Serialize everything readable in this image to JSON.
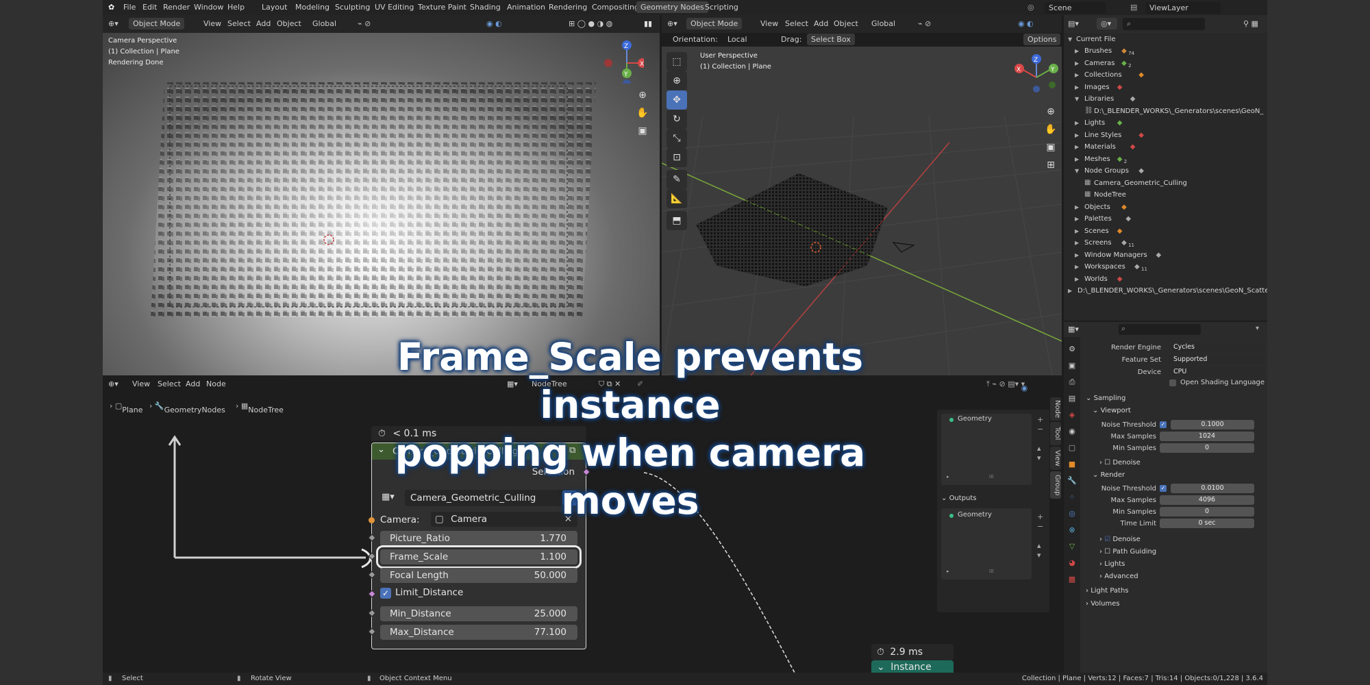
{
  "menu": {
    "file": "File",
    "edit": "Edit",
    "render": "Render",
    "window": "Window",
    "help": "Help"
  },
  "workspaces": [
    "Layout",
    "Modeling",
    "Sculpting",
    "UV Editing",
    "Texture Paint",
    "Shading",
    "Animation",
    "Rendering",
    "Compositing",
    "Geometry Nodes",
    "Scripting"
  ],
  "scene_name": "Scene",
  "view_layer": "ViewLayer",
  "viewport_left": {
    "mode": "Object Mode",
    "menus": [
      "View",
      "Select",
      "Add",
      "Object"
    ],
    "transform": "Global",
    "overlay_lines": [
      "Camera Perspective",
      "(1) Collection | Plane",
      "Rendering Done"
    ]
  },
  "viewport_right": {
    "mode": "Object Mode",
    "menus": [
      "View",
      "Select",
      "Add",
      "Object"
    ],
    "transform": "Global",
    "orientation_label": "Orientation:",
    "orientation_value": "Local",
    "drag_label": "Drag:",
    "drag_value": "Select Box",
    "options_label": "Options",
    "overlay_lines": [
      "User Perspective",
      "(1) Collection | Plane"
    ]
  },
  "gizmo": {
    "x": "X",
    "y": "Y",
    "z": "Z"
  },
  "outliner": {
    "root": "Current File",
    "items": [
      {
        "label": "Brushes",
        "badge": "74"
      },
      {
        "label": "Cameras",
        "badge": "2"
      },
      {
        "label": "Collections",
        "badge": ""
      },
      {
        "label": "Images",
        "badge": ""
      },
      {
        "label": "Libraries",
        "badge": ""
      },
      {
        "label": "D:\\_BLENDER_WORKS\\_Generators\\scenes\\GeoN_",
        "badge": ""
      },
      {
        "label": "Lights",
        "badge": ""
      },
      {
        "label": "Line Styles",
        "badge": ""
      },
      {
        "label": "Materials",
        "badge": ""
      },
      {
        "label": "Meshes",
        "badge": "2"
      },
      {
        "label": "Node Groups",
        "badge": ""
      },
      {
        "label": "Camera_Geometric_Culling",
        "badge": ""
      },
      {
        "label": "NodeTree",
        "badge": ""
      },
      {
        "label": "Objects",
        "badge": ""
      },
      {
        "label": "Palettes",
        "badge": ""
      },
      {
        "label": "Scenes",
        "badge": ""
      },
      {
        "label": "Screens",
        "badge": "11"
      },
      {
        "label": "Window Managers",
        "badge": ""
      },
      {
        "label": "Workspaces",
        "badge": "11"
      },
      {
        "label": "Worlds",
        "badge": ""
      },
      {
        "label": "D:\\_BLENDER_WORKS\\_Generators\\scenes\\GeoN_Scatter_",
        "badge": ""
      }
    ]
  },
  "properties": {
    "render_engine_label": "Render Engine",
    "render_engine": "Cycles",
    "feature_set_label": "Feature Set",
    "feature_set": "Supported",
    "device_label": "Device",
    "device": "CPU",
    "osl_label": "Open Shading Language",
    "sampling": "Sampling",
    "viewport": "Viewport",
    "noise_threshold_label": "Noise Threshold",
    "vp_noise": "0.1000",
    "max_samples_label": "Max Samples",
    "vp_max": "1024",
    "min_samples_label": "Min Samples",
    "vp_min": "0",
    "denoise": "Denoise",
    "render": "Render",
    "r_noise": "0.0100",
    "r_max": "4096",
    "r_min": "0",
    "time_limit_label": "Time Limit",
    "time_limit": "0 sec",
    "path_guiding": "Path Guiding",
    "lights": "Lights",
    "advanced": "Advanced",
    "light_paths": "Light Paths",
    "volumes": "Volumes"
  },
  "node_editor": {
    "menus": [
      "View",
      "Select",
      "Add",
      "Node"
    ],
    "tree_name": "NodeTree",
    "breadcrumb": [
      "Plane",
      "GeometryNodes",
      "NodeTree"
    ],
    "timing_top": "< 0.1 ms",
    "timing_bottom": "2.9 ms",
    "instance_label": "Instance",
    "tabs": [
      "Node",
      "Tool",
      "View",
      "Group"
    ],
    "geometry_label": "Geometry",
    "outputs_label": "Outputs"
  },
  "node": {
    "title": "Camera_Geometric_Culling",
    "output": "Selection",
    "group_name": "Camera_Geometric_Culling",
    "camera_label": "Camera:",
    "camera_value": "Camera",
    "picture_ratio_label": "Picture_Ratio",
    "picture_ratio": "1.770",
    "frame_scale_label": "Frame_Scale",
    "frame_scale": "1.100",
    "focal_length_label": "Focal Length",
    "focal_length": "50.000",
    "limit_distance_label": "Limit_Distance",
    "min_distance_label": "Min_Distance",
    "min_distance": "25.000",
    "max_distance_label": "Max_Distance",
    "max_distance": "77.100"
  },
  "callout": {
    "line1": "Frame_Scale prevents instance",
    "line2": "popping when camera moves"
  },
  "status": {
    "select": "Select",
    "rotate": "Rotate View",
    "context": "Object Context Menu",
    "stats": "Collection | Plane | Verts:12 | Faces:7 | Tris:14 | Objects:0/1,228 | 3.6.4"
  },
  "colors": {
    "accent": "#4a72b8",
    "node_header": "#3d5a2e",
    "callout_glow": "#1f4e8a"
  }
}
